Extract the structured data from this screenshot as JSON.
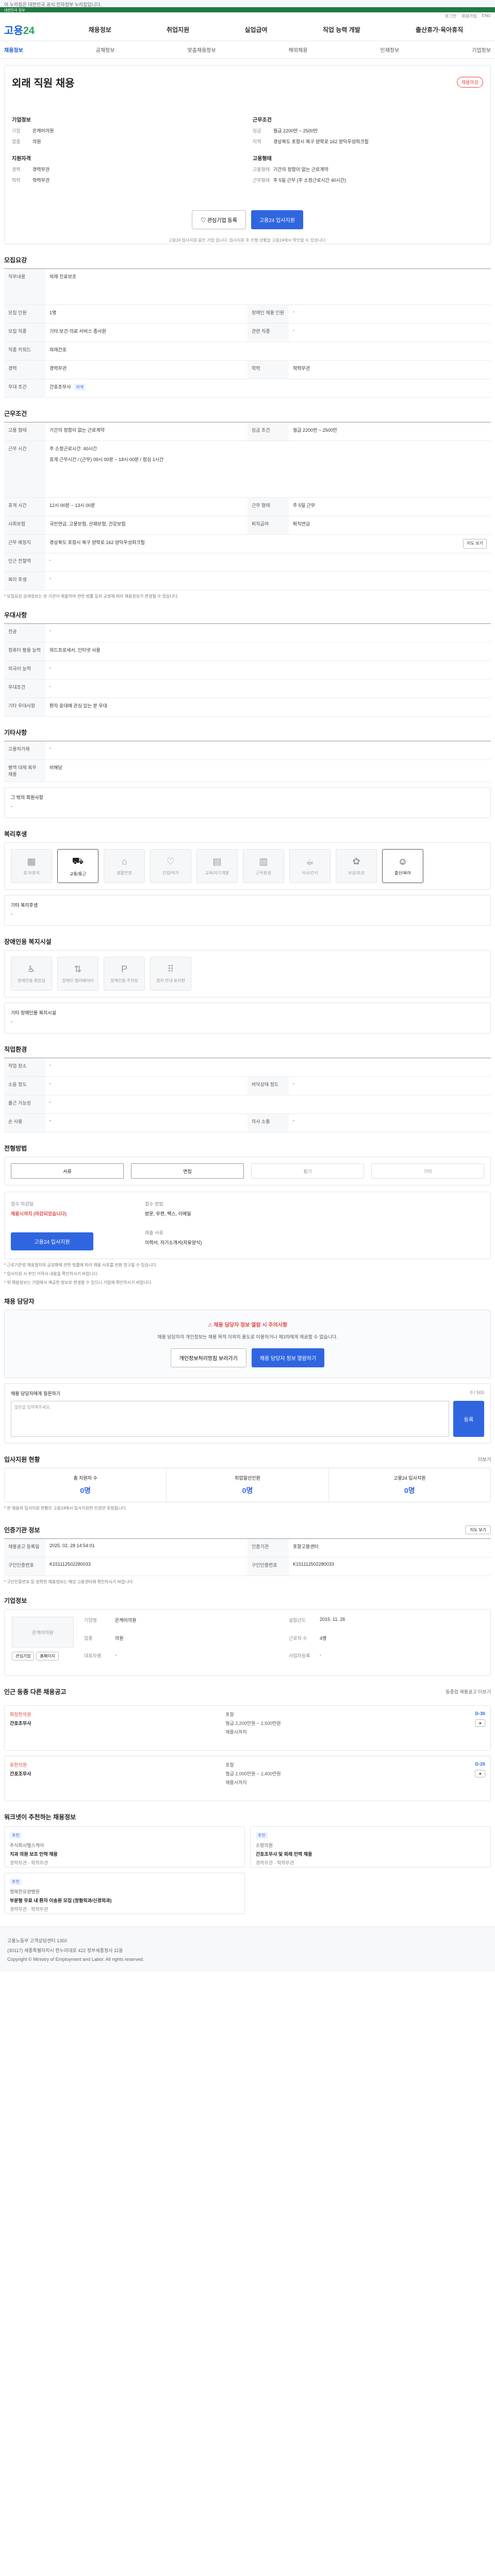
{
  "top": {
    "notice": "이 누리집은 대한민국 공식 전자정부 누리집입니다.",
    "gov": "대한민국 정부",
    "util": [
      "로그인",
      "회원가입",
      "ENG"
    ]
  },
  "header": {
    "logo_a": "고용",
    "logo_b": "24",
    "menu": [
      "채용정보",
      "취업지원",
      "실업급여",
      "직업 능력 개발",
      "출산휴가·육아휴직"
    ]
  },
  "subnav": {
    "items": [
      "채용정보",
      "공채정보",
      "맞춤채용정보",
      "해외채용",
      "인재정보",
      "기업정보"
    ],
    "active": "채용정보"
  },
  "job": {
    "title": "외래 직원 채용",
    "badge": "채용마감",
    "company_title": "기업정보",
    "company": [
      {
        "k": "기업",
        "v": "온케어의원"
      },
      {
        "k": "업종",
        "v": "의원"
      }
    ],
    "cond_title": "근무조건",
    "cond": [
      {
        "k": "임금",
        "v": "월급 2200만 ~ 2500만"
      },
      {
        "k": "지역",
        "v": "경상북도 포항시 북구 양학로 162 양덕우성파크힐"
      }
    ],
    "req_title": "지원자격",
    "req": [
      {
        "k": "경력",
        "v": "경력무관"
      },
      {
        "k": "학력",
        "v": "학력무관"
      }
    ],
    "form_title": "고용형태",
    "form": [
      {
        "k": "고용형태",
        "v": "기간의 정함이 없는 근로계약"
      },
      {
        "k": "근무형태",
        "v": "주 5일 근무 (주 소정근로시간 40시간)"
      }
    ],
    "btn_interest": "관심기업 등록",
    "btn_apply": "고용24 입사지원",
    "fine": "고용24 입사지원 중인 기업 입니다. 입사지원 후 진행 상황을 고용24에서 확인할 수 있습니다."
  },
  "recruit": {
    "title": "모집요강",
    "duty_label": "직무내용",
    "duty": "외래 진료보조",
    "rows": [
      {
        "k": "모집 인원",
        "v": "1명",
        "k2": "장애인 채용 인원",
        "v2": "-"
      },
      {
        "k": "모집 직종",
        "v": "기타 보건·의료 서비스 종사원",
        "k2": "관련 직종",
        "v2": "-"
      },
      {
        "k": "직종 키워드",
        "v": "외래간호",
        "k2": "",
        "v2": ""
      },
      {
        "k": "경력",
        "v": "경력무관",
        "k2": "학력",
        "v2": "학력무관"
      },
      {
        "k": "우대 조건",
        "v": "간호조무사",
        "k2": "",
        "v2": ""
      }
    ],
    "chip": "자격"
  },
  "work": {
    "title": "근무조건",
    "rows": [
      {
        "k": "고용 형태",
        "v": "기간의 정함이 없는 근로계약",
        "k2": "임금 조건",
        "v2": "월급 2200만 ~ 2500만"
      },
      {
        "k": "근무 시간",
        "v": "주 소정근로시간: 40시간",
        "k2": "",
        "v2": ""
      },
      {
        "k": "",
        "v": "휴게 근무시간 / (근무) 09시 00분 ~ 18시 00분 / 점심 1시간",
        "k2": "",
        "v2": ""
      },
      {
        "k": "휴게 시간",
        "v": "12시 00분 ~ 13시 00분",
        "k2": "근무 형태",
        "v2": "주 5일 근무"
      },
      {
        "k": "사회보험",
        "v": "국민연금, 고용보험, 산재보험, 건강보험",
        "k2": "퇴직급여",
        "v2": "퇴직연금"
      },
      {
        "k": "근무 예정지",
        "v": "경상북도 포항시 북구 양학로 162 양덕우성파크힐",
        "k2": "",
        "v2": ""
      },
      {
        "k": "인근 전철역",
        "v": "-",
        "k2": "",
        "v2": ""
      },
      {
        "k": "복리 후생",
        "v": "-",
        "k2": "",
        "v2": ""
      }
    ],
    "map_button": "지도 보기",
    "note": "* 모집요강 상세정보는 본 기관이 제출하여 관련 법률 등의 규정에 따라 채용정보가 변경될 수 있습니다."
  },
  "prefer": {
    "title": "우대사항",
    "rows": [
      {
        "k": "전공",
        "v": "-"
      },
      {
        "k": "컴퓨터 활용 능력",
        "v": "워드프로세서, 인터넷 사용"
      },
      {
        "k": "외국어 능력",
        "v": "-"
      },
      {
        "k": "우대조건",
        "v": "-"
      },
      {
        "k": "기타 우대사항",
        "v": "환자 응대에 관심 있는 분 우대"
      }
    ]
  },
  "etc": {
    "title": "기타사항",
    "rows": [
      {
        "k": "고용허가제",
        "v": "-"
      },
      {
        "k": "병역 대체 복무 채용",
        "v": "비해당"
      }
    ],
    "etc_label": "그 밖의 회원사항",
    "etc_value": "-"
  },
  "welfare": {
    "title": "복리후생",
    "tiles": [
      {
        "label": "휴가/휴직",
        "on": false,
        "icon": "calendar-icon",
        "glyph": "▦"
      },
      {
        "label": "교통/통근",
        "on": true,
        "icon": "car-icon",
        "glyph": "⛟"
      },
      {
        "label": "생활안정",
        "on": false,
        "icon": "home-icon",
        "glyph": "⌂"
      },
      {
        "label": "건강/여가",
        "on": false,
        "icon": "heart-icon",
        "glyph": "♡"
      },
      {
        "label": "교육/자기개발",
        "on": false,
        "icon": "book-icon",
        "glyph": "▤"
      },
      {
        "label": "근무환경",
        "on": false,
        "icon": "building-icon",
        "glyph": "▥"
      },
      {
        "label": "식사/간식",
        "on": false,
        "icon": "cup-icon",
        "glyph": "☕"
      },
      {
        "label": "보상/포상",
        "on": false,
        "icon": "gift-icon",
        "glyph": "✿"
      },
      {
        "label": "출산/육아",
        "on": true,
        "icon": "baby-icon",
        "glyph": "☺"
      }
    ],
    "etc_label": "기타 복리후생",
    "etc_value": "-"
  },
  "disabled": {
    "title": "장애인용 복지시설",
    "tiles": [
      {
        "label": "장애인용 화장실",
        "icon": "toilet-icon",
        "glyph": "♿"
      },
      {
        "label": "장애인 엘리베이터",
        "icon": "elevator-icon",
        "glyph": "⇅"
      },
      {
        "label": "장애인용 주차장",
        "icon": "parking-icon",
        "glyph": "P"
      },
      {
        "label": "점자 안내 표지판",
        "icon": "braille-icon",
        "glyph": "⠿"
      }
    ],
    "etc_label": "기타 장애인용 복지시설",
    "etc_value": "-"
  },
  "company_info": {
    "title": "직업환경",
    "rows": [
      {
        "k": "작업 장소",
        "v": "-",
        "k2": "",
        "v2": ""
      },
      {
        "k": "소음 정도",
        "v": "-",
        "k2": "바닥상태 정도",
        "v2": "-"
      },
      {
        "k": "출근 가능성",
        "v": "-",
        "k2": "",
        "v2": ""
      },
      {
        "k": "손 사용",
        "v": "-",
        "k2": "의사 소통",
        "v2": "-"
      }
    ]
  },
  "select_method": {
    "title": "전형방법",
    "items": [
      {
        "label": "서류",
        "on": true
      },
      {
        "label": "면접",
        "on": true
      },
      {
        "label": "필기",
        "on": false
      },
      {
        "label": "기타",
        "on": false
      }
    ]
  },
  "apply": {
    "deadline_label": "접수 마감일",
    "deadline": "채용시까지 (마감되었습니다)",
    "method_label": "접수 방법",
    "method": "방문, 우편, 팩스, 이메일",
    "doc_label": "제출 서류",
    "doc": "이력서, 자기소개서(자유양식)",
    "btn": "고용24 입사지원",
    "notes": [
      "* 근로기준법 채용절차의 공정화에 관한 법률에 따라 채용 서류를 반환 청구할 수 있습니다.",
      "* 입사지원 시 본인 이력서 내용을 확인하시기 바랍니다.",
      "* 위 채용정보는 기업에서 제공한 정보로 변경될 수 있으니 기업에 확인하시기 바랍니다."
    ]
  },
  "inquiry": {
    "title": "채용 담당자",
    "alert_title": "채용 담당자 정보 열람 시 주의사항",
    "alert_text": "채용 담당자의 개인정보는 채용 목적 이외의 용도로 이용하거나 제3자에게 제공할 수 없습니다.",
    "btn_privacy": "개인정보처리방침 보러가기",
    "btn_view": "채용 담당자 정보 열람하기",
    "qa_label": "채용 담당자에게 질문하기",
    "qa_count": "0 / 500",
    "qa_placeholder": "질문을 입력해주세요.",
    "qa_btn": "등록"
  },
  "stats": {
    "title": "입사지원 현황",
    "more": "더보기",
    "items": [
      {
        "label": "총 지원자 수",
        "value": "0명"
      },
      {
        "label": "취업알선인원",
        "value": "0명"
      },
      {
        "label": "고용24 입사지원",
        "value": "0명"
      }
    ],
    "note": "* 본 채용의 입사지원 현황은 고용24에서 입사지원한 인원만 포함됩니다."
  },
  "post_info": {
    "title": "인증기관 정보",
    "rows": [
      {
        "k": "채용공고 등록일",
        "v": "2025. 02. 28 14:54:01",
        "k2": "인증기관",
        "v2": "포항고용센터"
      },
      {
        "k": "구인인증번호",
        "v": "K151112502280033",
        "k2": "구인인증번호",
        "v2": "K151112502280033"
      }
    ],
    "map_btn": "지도 보기",
    "note": "* 구인인증번호 등 정확한 채용정보는 해당 고용센터에 확인하시기 바랍니다."
  },
  "firm": {
    "title": "기업정보",
    "name": "온케어의원",
    "rows": [
      {
        "k": "기업명",
        "v": "온케어의원"
      },
      {
        "k": "업종",
        "v": "의원"
      },
      {
        "k": "대표자명",
        "v": "-"
      },
      {
        "k": "근로자 수",
        "v": "4명"
      },
      {
        "k": "설립년도",
        "v": "2015. 11. 26"
      },
      {
        "k": "사업자등록",
        "v": "-"
      }
    ],
    "btn_interest": "관심기업",
    "btn_homepage": "홈페이지"
  },
  "related": {
    "title": "인근 동종 다른 채용공고",
    "more": "동종업 채용공고 더보기",
    "items": [
      {
        "company": "화정한의원",
        "title": "간호조무사",
        "region": "포항",
        "wage": "월급 2,200만원 ~ 2,500만원",
        "deadline": "채용시까지",
        "dday": "D-30"
      },
      {
        "company": "유한의원",
        "title": "간호조무사",
        "region": "포항",
        "wage": "월급 2,000만원 ~ 2,400만원",
        "deadline": "채용시까지",
        "dday": "D-20"
      }
    ]
  },
  "picks": {
    "title": "워크넷이 추천하는 채용정보",
    "items": [
      {
        "tag": "추천",
        "company": "주식회사헬스케어",
        "title": "치과 의원 보조 인력 채용",
        "meta": "경력무관 · 학력무관"
      },
      {
        "tag": "추천",
        "company": "소망의원",
        "title": "간호조무사 및 외래 인력 채용",
        "meta": "경력무관 · 학력무관"
      },
      {
        "tag": "추천",
        "company": "행복한요양병원",
        "title": "부분형 무료 내 환자 이송원 모집 (정형외과/신경외과)",
        "meta": "경력무관 · 학력무관"
      }
    ]
  },
  "footer": {
    "lines": [
      "고용노동부 고객상담센터 1350",
      "(30117) 세종특별자치시 한누리대로 422 정부세종청사 11동",
      "Copyright © Ministry of Employment and Labor. All rights reserved."
    ]
  }
}
